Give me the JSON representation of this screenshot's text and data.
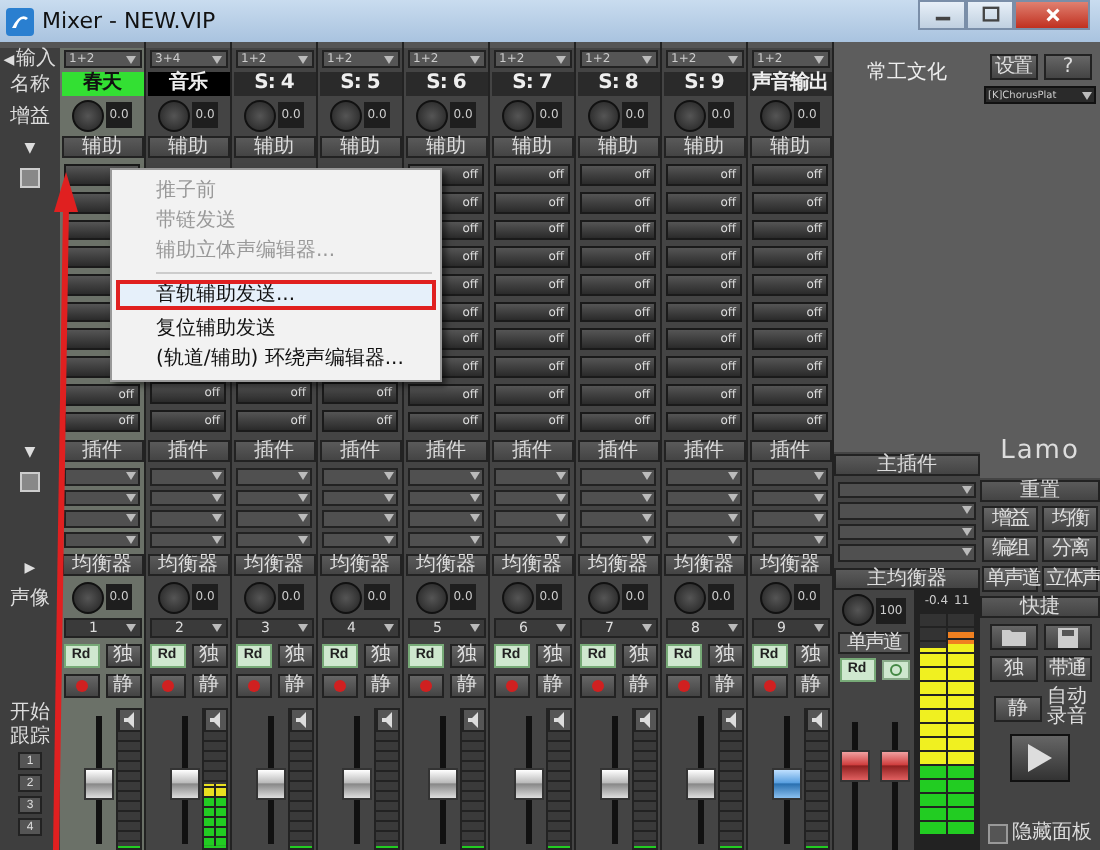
{
  "window": {
    "title": "Mixer - NEW.VIP"
  },
  "row_labels": {
    "input_arrow": "◀",
    "input": "输入",
    "name": "名称",
    "gain": "增益",
    "aux_toggle": "▼",
    "plugins_toggle": "▼",
    "eq_toggle": "▶",
    "pan": "声像",
    "start": "开始",
    "follow": "跟踪",
    "markers": [
      "1",
      "2",
      "3",
      "4"
    ]
  },
  "channels": [
    {
      "input": "1+2",
      "name": "春天",
      "color": "#33e033",
      "selected": true,
      "gain": "0.0",
      "aux": "辅助",
      "plugins": "插件",
      "eq": "均衡器",
      "pan": "0.0",
      "number": "1",
      "read": "Rd",
      "solo": "独",
      "mute": "静",
      "kind": "plain",
      "level": 0.45,
      "meter": {
        "level": 0
      }
    },
    {
      "input": "3+4",
      "name": "音乐",
      "color": "#000000",
      "selected": false,
      "gain": "0.0",
      "aux": "辅助",
      "plugins": "插件",
      "eq": "均衡器",
      "pan": "0.0",
      "number": "2",
      "read": "Rd",
      "solo": "独",
      "mute": "静",
      "kind": "plain",
      "level": 0.45,
      "meter": {
        "level": 0.55
      }
    },
    {
      "input": "1+2",
      "name": "S: 4",
      "color": "#2a2a2a",
      "selected": false,
      "gain": "0.0",
      "aux": "辅助",
      "plugins": "插件",
      "eq": "均衡器",
      "pan": "0.0",
      "number": "3",
      "read": "Rd",
      "solo": "独",
      "mute": "静",
      "kind": "plain",
      "level": 0.45,
      "meter": {
        "level": 0
      }
    },
    {
      "input": "1+2",
      "name": "S: 5",
      "color": "#2a2a2a",
      "selected": false,
      "gain": "0.0",
      "aux": "辅助",
      "plugins": "插件",
      "eq": "均衡器",
      "pan": "0.0",
      "number": "4",
      "read": "Rd",
      "solo": "独",
      "mute": "静",
      "kind": "plain",
      "level": 0.45,
      "meter": {
        "level": 0
      }
    },
    {
      "input": "1+2",
      "name": "S: 6",
      "color": "#2a2a2a",
      "selected": false,
      "gain": "0.0",
      "aux": "辅助",
      "plugins": "插件",
      "eq": "均衡器",
      "pan": "0.0",
      "number": "5",
      "read": "Rd",
      "solo": "独",
      "mute": "静",
      "kind": "plain",
      "level": 0.45,
      "meter": {
        "level": 0
      }
    },
    {
      "input": "1+2",
      "name": "S: 7",
      "color": "#2a2a2a",
      "selected": false,
      "gain": "0.0",
      "aux": "辅助",
      "plugins": "插件",
      "eq": "均衡器",
      "pan": "0.0",
      "number": "6",
      "read": "Rd",
      "solo": "独",
      "mute": "静",
      "kind": "plain",
      "level": 0.45,
      "meter": {
        "level": 0
      }
    },
    {
      "input": "1+2",
      "name": "S: 8",
      "color": "#2a2a2a",
      "selected": false,
      "gain": "0.0",
      "aux": "辅助",
      "plugins": "插件",
      "eq": "均衡器",
      "pan": "0.0",
      "number": "7",
      "read": "Rd",
      "solo": "独",
      "mute": "静",
      "kind": "plain",
      "level": 0.45,
      "meter": {
        "level": 0
      }
    },
    {
      "input": "1+2",
      "name": "S: 9",
      "color": "#2a2a2a",
      "selected": false,
      "gain": "0.0",
      "aux": "辅助",
      "plugins": "插件",
      "eq": "均衡器",
      "pan": "0.0",
      "number": "8",
      "read": "Rd",
      "solo": "独",
      "mute": "静",
      "kind": "plain",
      "level": 0.45,
      "meter": {
        "level": 0
      }
    },
    {
      "input": "1+2",
      "name": "声音输出",
      "color": "#2a2a2a",
      "selected": false,
      "gain": "0.0",
      "aux": "辅助",
      "plugins": "插件",
      "eq": "均衡器",
      "pan": "0.0",
      "number": "9",
      "read": "Rd",
      "solo": "独",
      "mute": "静",
      "kind": "blue",
      "level": 0.45,
      "meter": {
        "level": 0
      }
    }
  ],
  "sends": [
    {
      "cells": [
        {
          "kind": "blank"
        },
        null,
        null,
        null,
        {
          "kind": "labeled",
          "label": "off"
        },
        {
          "kind": "labeled",
          "label": "off"
        },
        {
          "kind": "labeled",
          "label": "off"
        },
        {
          "kind": "labeled",
          "label": "off"
        },
        {
          "kind": "labeled",
          "label": "off"
        }
      ]
    },
    {
      "cells": [
        {
          "kind": "blank"
        },
        null,
        null,
        null,
        {
          "kind": "labeled",
          "label": "off"
        },
        {
          "kind": "labeled",
          "label": "off"
        },
        {
          "kind": "labeled",
          "label": "off"
        },
        {
          "kind": "labeled",
          "label": "off"
        },
        {
          "kind": "labeled",
          "label": "off"
        }
      ]
    },
    {
      "cells": [
        {
          "kind": "blank"
        },
        null,
        null,
        null,
        {
          "kind": "labeled",
          "label": "off"
        },
        {
          "kind": "labeled",
          "label": "off"
        },
        {
          "kind": "labeled",
          "label": "off"
        },
        {
          "kind": "labeled",
          "label": "off"
        },
        {
          "kind": "labeled",
          "label": "off"
        }
      ]
    },
    {
      "cells": [
        {
          "kind": "blank"
        },
        null,
        null,
        null,
        {
          "kind": "labeled",
          "label": "off"
        },
        {
          "kind": "labeled",
          "label": "off"
        },
        {
          "kind": "labeled",
          "label": "off"
        },
        {
          "kind": "labeled",
          "label": "off"
        },
        {
          "kind": "labeled",
          "label": "off"
        }
      ]
    },
    {
      "cells": [
        {
          "kind": "blank"
        },
        null,
        null,
        null,
        {
          "kind": "labeled",
          "label": "off"
        },
        {
          "kind": "labeled",
          "label": "off"
        },
        {
          "kind": "labeled",
          "label": "off"
        },
        {
          "kind": "labeled",
          "label": "off"
        },
        {
          "kind": "labeled",
          "label": "off"
        }
      ]
    },
    {
      "cells": [
        {
          "kind": "blank"
        },
        null,
        null,
        null,
        {
          "kind": "labeled",
          "label": "off"
        },
        {
          "kind": "labeled",
          "label": "off"
        },
        {
          "kind": "labeled",
          "label": "off"
        },
        {
          "kind": "labeled",
          "label": "off"
        },
        {
          "kind": "labeled",
          "label": "off"
        }
      ]
    },
    {
      "cells": [
        {
          "kind": "blank"
        },
        null,
        null,
        null,
        {
          "kind": "labeled",
          "label": "off"
        },
        {
          "kind": "labeled",
          "label": "off"
        },
        {
          "kind": "labeled",
          "label": "off"
        },
        {
          "kind": "labeled",
          "label": "off"
        },
        {
          "kind": "labeled",
          "label": "off"
        }
      ]
    },
    {
      "cells": [
        {
          "kind": "blank"
        },
        null,
        null,
        null,
        {
          "kind": "labeled",
          "label": "off"
        },
        {
          "kind": "labeled",
          "label": "off"
        },
        {
          "kind": "labeled",
          "label": "off"
        },
        {
          "kind": "labeled",
          "label": "off"
        },
        {
          "kind": "labeled",
          "label": "off"
        }
      ]
    },
    {
      "cells": [
        {
          "kind": "labeled",
          "label": "off"
        },
        {
          "kind": "labeled",
          "label": "off"
        },
        {
          "kind": "labeled",
          "label": "off"
        },
        {
          "kind": "labeled",
          "label": "off"
        },
        {
          "kind": "labeled",
          "label": "off"
        },
        {
          "kind": "labeled",
          "label": "off"
        },
        {
          "kind": "labeled",
          "label": "off"
        },
        {
          "kind": "labeled",
          "label": "off"
        },
        {
          "kind": "labeled",
          "label": "off"
        }
      ]
    },
    {
      "cells": [
        {
          "kind": "labeled",
          "label": "off"
        },
        {
          "kind": "labeled",
          "label": "off"
        },
        {
          "kind": "labeled",
          "label": "off"
        },
        {
          "kind": "labeled",
          "label": "off"
        },
        {
          "kind": "labeled",
          "label": "off"
        },
        {
          "kind": "labeled",
          "label": "off"
        },
        {
          "kind": "labeled",
          "label": "off"
        },
        {
          "kind": "labeled",
          "label": "off"
        },
        {
          "kind": "labeled",
          "label": "off"
        }
      ]
    }
  ],
  "master": {
    "caption": "常工文化",
    "plugins": "主插件",
    "eq": "主均衡器",
    "volume": "100",
    "mono": "单声道",
    "read": "Rd",
    "level": 0.7,
    "peaks": [
      "-0.4",
      "11"
    ],
    "meters": [
      {
        "level": 0.85
      },
      {
        "level": 0.92
      }
    ]
  },
  "side": {
    "setup": "设置",
    "help": "?",
    "preset": "[K]ChorusPlat",
    "logo": "Lamo",
    "reset": "重置",
    "buttons": [
      "增益",
      "均衡",
      "编组",
      "分离",
      "单声道",
      "立体声"
    ],
    "quick": "快捷",
    "solo": "独",
    "bypass": "带通",
    "mute": "静",
    "auto": "自动",
    "record": "录音",
    "hide": {
      "label": "隐藏面板",
      "checked": false
    }
  },
  "menu": [
    {
      "kind": "item",
      "label": "推子前",
      "disabled": true,
      "selected": false
    },
    {
      "kind": "item",
      "label": "带链发送",
      "disabled": true,
      "selected": false
    },
    {
      "kind": "item",
      "label": "辅助立体声编辑器...",
      "disabled": true,
      "selected": false
    },
    {
      "kind": "separator"
    },
    {
      "kind": "item",
      "label": "音轨辅助发送...",
      "disabled": false,
      "selected": true
    },
    {
      "kind": "item",
      "label": "复位辅助发送",
      "disabled": false,
      "selected": false
    },
    {
      "kind": "item",
      "label": "(轨道/辅助) 环绕声编辑器...",
      "disabled": false,
      "selected": false
    }
  ]
}
